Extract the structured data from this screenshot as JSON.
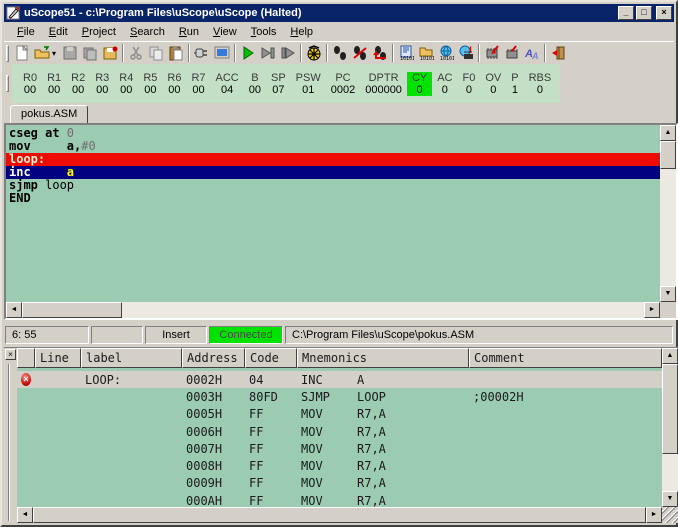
{
  "window": {
    "title": "uScope51 - c:\\Program Files\\uScope\\uScope (Halted)",
    "minimize": "_",
    "maximize": "□",
    "close": "×"
  },
  "menu": {
    "items": [
      {
        "key": "F",
        "rest": "ile"
      },
      {
        "key": "E",
        "rest": "dit"
      },
      {
        "key": "P",
        "rest": "roject"
      },
      {
        "key": "S",
        "rest": "earch"
      },
      {
        "key": "R",
        "rest": "un"
      },
      {
        "key": "V",
        "rest": "iew"
      },
      {
        "key": "T",
        "rest": "ools"
      },
      {
        "key": "H",
        "rest": "elp"
      }
    ]
  },
  "toolbar": {
    "icons": [
      "new-file",
      "open-file",
      "save",
      "save-all",
      "save-project",
      "cut",
      "copy",
      "paste",
      "connect",
      "monitor",
      "run",
      "run-to-cursor",
      "step-animate",
      "reset",
      "step-into",
      "step-over",
      "step-out",
      "view-code",
      "view-data",
      "view-sfr",
      "update-chip",
      "read-chip",
      "write-chip",
      "font",
      "exit"
    ],
    "open_caret": "▾"
  },
  "registers": [
    {
      "name": "R0",
      "value": "00"
    },
    {
      "name": "R1",
      "value": "00"
    },
    {
      "name": "R2",
      "value": "00"
    },
    {
      "name": "R3",
      "value": "00"
    },
    {
      "name": "R4",
      "value": "00"
    },
    {
      "name": "R5",
      "value": "00"
    },
    {
      "name": "R6",
      "value": "00"
    },
    {
      "name": "R7",
      "value": "00"
    },
    {
      "name": "ACC",
      "value": "04"
    },
    {
      "name": "B",
      "value": "00"
    },
    {
      "name": "SP",
      "value": "07"
    },
    {
      "name": "PSW",
      "value": "01"
    },
    {
      "name": "PC",
      "value": "0002"
    },
    {
      "name": "DPTR",
      "value": "000000"
    },
    {
      "name": "CY",
      "value": "0",
      "highlight": true
    },
    {
      "name": "AC",
      "value": "0"
    },
    {
      "name": "F0",
      "value": "0"
    },
    {
      "name": "OV",
      "value": "0"
    },
    {
      "name": "P",
      "value": "1"
    },
    {
      "name": "RBS",
      "value": "0"
    }
  ],
  "editor": {
    "tab": "pokus.ASM",
    "l1": {
      "kw": "cseg at ",
      "num": "0"
    },
    "l2": {
      "kw": "mov     a,",
      "num": "#0"
    },
    "l3": {
      "label": "loop:"
    },
    "l4": {
      "kw": "inc     ",
      "op": "a"
    },
    "l5": {
      "kw": "sjmp",
      "rest": " loop"
    },
    "l6": {
      "kw": "END"
    }
  },
  "statusbar": {
    "position": "6: 55",
    "panel2": "",
    "mode": "Insert",
    "connection": "Connected",
    "file": "C:\\Program Files\\uScope\\pokus.ASM"
  },
  "disassembly": {
    "headers": {
      "icon": "",
      "line": "Line",
      "label": "label",
      "address": "Address",
      "code": "Code",
      "mnemonics": "Mnemonics",
      "comment": "Comment"
    },
    "rows": [
      {
        "line": "",
        "label": "LOOP:",
        "address": "0002H",
        "code": "04",
        "mnemonic": "INC",
        "operand": "A",
        "comment": ""
      },
      {
        "line": "",
        "label": "",
        "address": "0003H",
        "code": "80FD",
        "mnemonic": "SJMP",
        "operand": "LOOP",
        "comment": ";00002H"
      },
      {
        "line": "",
        "label": "",
        "address": "0005H",
        "code": "FF",
        "mnemonic": "MOV",
        "operand": "R7,A",
        "comment": ""
      },
      {
        "line": "",
        "label": "",
        "address": "0006H",
        "code": "FF",
        "mnemonic": "MOV",
        "operand": "R7,A",
        "comment": ""
      },
      {
        "line": "",
        "label": "",
        "address": "0007H",
        "code": "FF",
        "mnemonic": "MOV",
        "operand": "R7,A",
        "comment": ""
      },
      {
        "line": "",
        "label": "",
        "address": "0008H",
        "code": "FF",
        "mnemonic": "MOV",
        "operand": "R7,A",
        "comment": ""
      },
      {
        "line": "",
        "label": "",
        "address": "0009H",
        "code": "FF",
        "mnemonic": "MOV",
        "operand": "R7,A",
        "comment": ""
      },
      {
        "line": "",
        "label": "",
        "address": "000AH",
        "code": "FF",
        "mnemonic": "MOV",
        "operand": "R7,A",
        "comment": ""
      }
    ],
    "breakpoint_glyph": "×"
  },
  "colors": {
    "titlebar": "#0a246a",
    "chrome": "#d4d0c8",
    "editor_bg": "#9bccb2",
    "register_bg": "#c3e0c6",
    "highlight_green": "#00e300",
    "current_label_line": "#ee0b00",
    "current_exec_line": "#000080"
  }
}
